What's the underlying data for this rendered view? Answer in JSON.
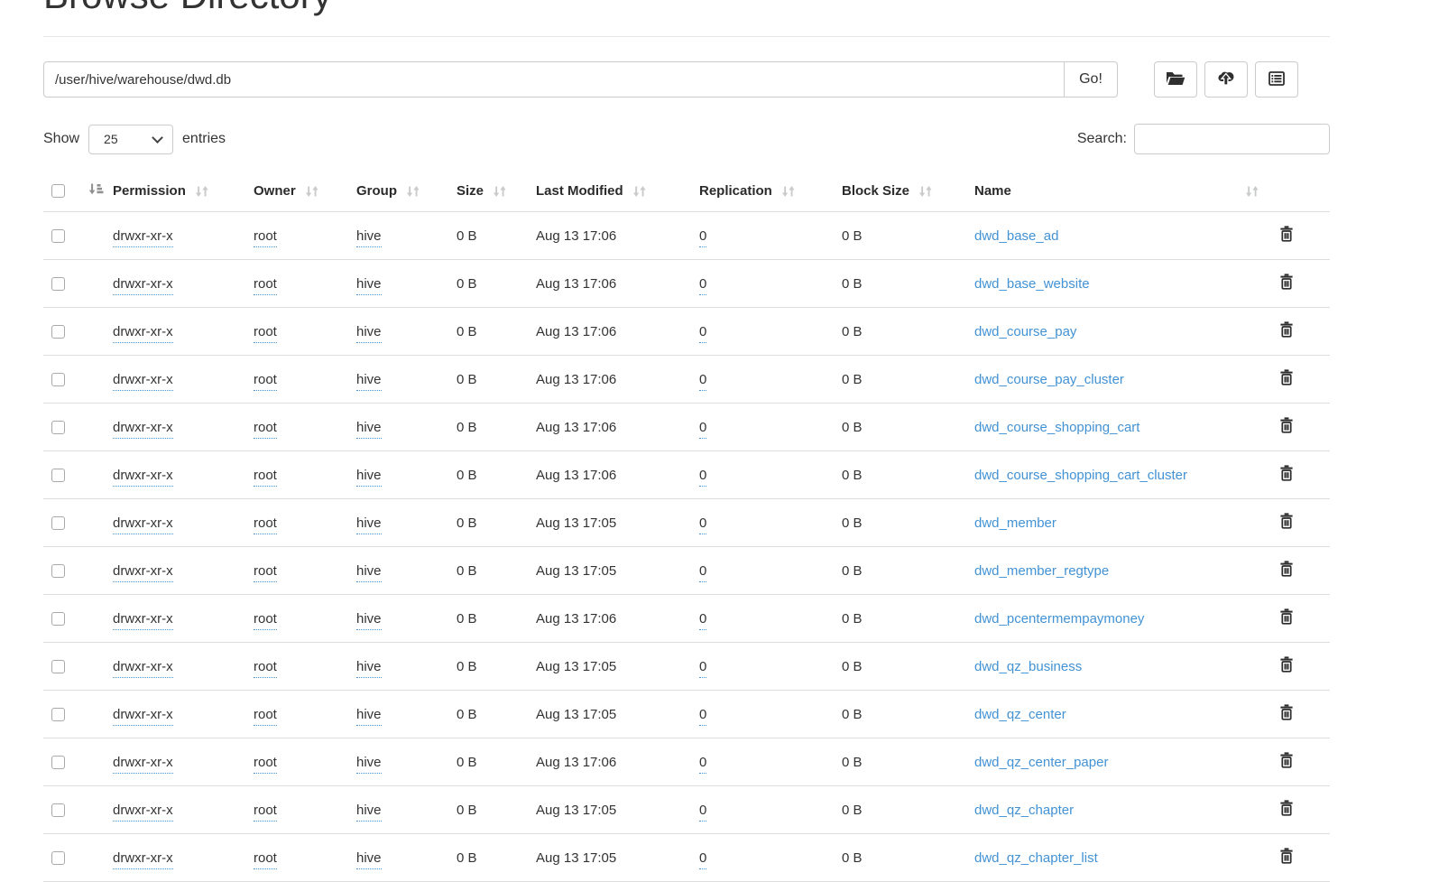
{
  "page": {
    "title": "Browse Directory"
  },
  "toolbar": {
    "path_value": "/user/hive/warehouse/dwd.db",
    "go_label": "Go!",
    "buttons": [
      {
        "icon": "folder-open-icon",
        "purpose": "create-directory"
      },
      {
        "icon": "cloud-upload-icon",
        "purpose": "upload-files"
      },
      {
        "icon": "list-alt-icon",
        "purpose": "cut-and-paste"
      }
    ]
  },
  "controls": {
    "show_label": "Show",
    "entries_label": "entries",
    "page_size": "25",
    "search_label": "Search:",
    "search_value": ""
  },
  "table": {
    "columns": {
      "permission": "Permission",
      "owner": "Owner",
      "group": "Group",
      "size": "Size",
      "modified": "Last Modified",
      "replication": "Replication",
      "block_size": "Block Size",
      "name": "Name"
    },
    "rows": [
      {
        "permission": "drwxr-xr-x",
        "owner": "root",
        "group": "hive",
        "size": "0 B",
        "modified": "Aug 13 17:06",
        "replication": "0",
        "block_size": "0 B",
        "name": "dwd_base_ad"
      },
      {
        "permission": "drwxr-xr-x",
        "owner": "root",
        "group": "hive",
        "size": "0 B",
        "modified": "Aug 13 17:06",
        "replication": "0",
        "block_size": "0 B",
        "name": "dwd_base_website"
      },
      {
        "permission": "drwxr-xr-x",
        "owner": "root",
        "group": "hive",
        "size": "0 B",
        "modified": "Aug 13 17:06",
        "replication": "0",
        "block_size": "0 B",
        "name": "dwd_course_pay"
      },
      {
        "permission": "drwxr-xr-x",
        "owner": "root",
        "group": "hive",
        "size": "0 B",
        "modified": "Aug 13 17:06",
        "replication": "0",
        "block_size": "0 B",
        "name": "dwd_course_pay_cluster"
      },
      {
        "permission": "drwxr-xr-x",
        "owner": "root",
        "group": "hive",
        "size": "0 B",
        "modified": "Aug 13 17:06",
        "replication": "0",
        "block_size": "0 B",
        "name": "dwd_course_shopping_cart"
      },
      {
        "permission": "drwxr-xr-x",
        "owner": "root",
        "group": "hive",
        "size": "0 B",
        "modified": "Aug 13 17:06",
        "replication": "0",
        "block_size": "0 B",
        "name": "dwd_course_shopping_cart_cluster"
      },
      {
        "permission": "drwxr-xr-x",
        "owner": "root",
        "group": "hive",
        "size": "0 B",
        "modified": "Aug 13 17:05",
        "replication": "0",
        "block_size": "0 B",
        "name": "dwd_member"
      },
      {
        "permission": "drwxr-xr-x",
        "owner": "root",
        "group": "hive",
        "size": "0 B",
        "modified": "Aug 13 17:05",
        "replication": "0",
        "block_size": "0 B",
        "name": "dwd_member_regtype"
      },
      {
        "permission": "drwxr-xr-x",
        "owner": "root",
        "group": "hive",
        "size": "0 B",
        "modified": "Aug 13 17:06",
        "replication": "0",
        "block_size": "0 B",
        "name": "dwd_pcentermempaymoney"
      },
      {
        "permission": "drwxr-xr-x",
        "owner": "root",
        "group": "hive",
        "size": "0 B",
        "modified": "Aug 13 17:05",
        "replication": "0",
        "block_size": "0 B",
        "name": "dwd_qz_business"
      },
      {
        "permission": "drwxr-xr-x",
        "owner": "root",
        "group": "hive",
        "size": "0 B",
        "modified": "Aug 13 17:05",
        "replication": "0",
        "block_size": "0 B",
        "name": "dwd_qz_center"
      },
      {
        "permission": "drwxr-xr-x",
        "owner": "root",
        "group": "hive",
        "size": "0 B",
        "modified": "Aug 13 17:06",
        "replication": "0",
        "block_size": "0 B",
        "name": "dwd_qz_center_paper"
      },
      {
        "permission": "drwxr-xr-x",
        "owner": "root",
        "group": "hive",
        "size": "0 B",
        "modified": "Aug 13 17:05",
        "replication": "0",
        "block_size": "0 B",
        "name": "dwd_qz_chapter"
      },
      {
        "permission": "drwxr-xr-x",
        "owner": "root",
        "group": "hive",
        "size": "0 B",
        "modified": "Aug 13 17:05",
        "replication": "0",
        "block_size": "0 B",
        "name": "dwd_qz_chapter_list"
      }
    ]
  },
  "colors": {
    "link": "#4292d4",
    "editable_underline": "#4a94d6",
    "sort_inactive": "#c9cacb",
    "sort_active": "#8f8f8f",
    "icon": "#2f2f2f",
    "row_border": "#dddddd"
  }
}
